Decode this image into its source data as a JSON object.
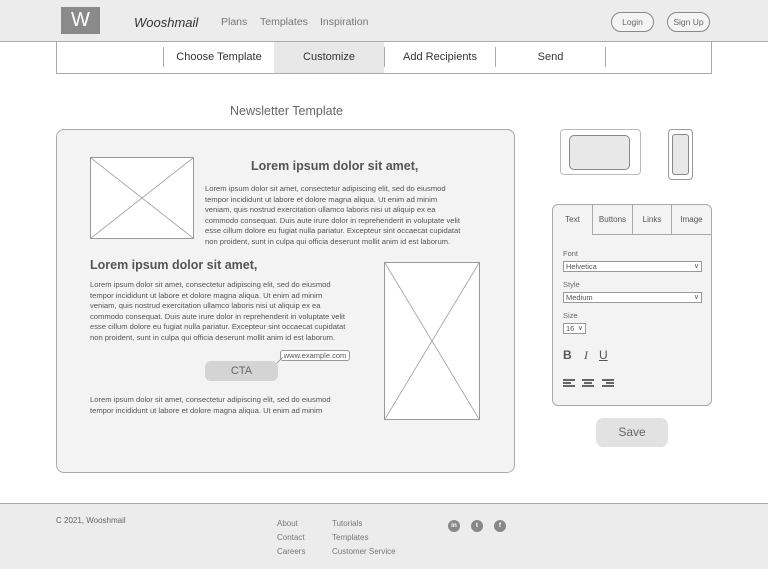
{
  "header": {
    "logo": "W",
    "brand": "Wooshmail",
    "nav": [
      "Plans",
      "Templates",
      "Inspiration"
    ],
    "login_label": "Login",
    "signup_label": "Sign Up"
  },
  "steps": [
    "Choose Template",
    "Customize",
    "Add Recipients",
    "Send"
  ],
  "page_title": "Newsletter Template",
  "template": {
    "heading1": "Lorem ipsum dolor sit amet,",
    "body1": [
      "Lorem ipsum dolor sit amet, consectetur adipiscing elit, sed do eiusmod",
      "tempor incididunt ut labore et dolore magna aliqua. Ut enim ad minim",
      "veniam, quis nostrud exercitation ullamco laboris nisi ut aliquip ex ea",
      "commodo consequat. Duis aute irure dolor in reprehenderit in voluptate velit",
      "esse cillum dolore eu fugiat nulla pariatur. Excepteur sint occaecat cupidatat",
      "non proident, sunt in culpa qui officia deserunt mollit anim id est laborum."
    ],
    "heading2": "Lorem ipsum dolor sit amet,",
    "body2": [
      "Lorem ipsum dolor sit amet, consectetur adipiscing elit, sed do eiusmod",
      "tempor incididunt ut labore et dolore magna aliqua. Ut enim ad minim",
      "veniam, quis nostrud exercitation ullamco laboris nisi ut aliquip ex ea",
      "commodo consequat. Duis aute irure dolor in reprehenderit in voluptate velit",
      "esse cillum dolore eu fugiat nulla pariatur. Excepteur sint occaecat cupidatat",
      "non proident, sunt in culpa qui officia deserunt mollit anim id est laborum."
    ],
    "url": "www.example.com",
    "cta_label": "CTA",
    "body3": [
      "Lorem ipsum dolor sit amet, consectetur adipiscing elit, sed do eiusmod",
      "tempor incididunt ut labore et dolore magna aliqua. Ut enim ad minim"
    ]
  },
  "panel": {
    "tabs": [
      "Text",
      "Buttons",
      "Links",
      "Image"
    ],
    "font_label": "Font",
    "font_value": "Helvetica",
    "style_label": "Style",
    "style_value": "Medium",
    "size_label": "Size",
    "size_value": "16",
    "bold": "B",
    "italic": "I",
    "underline": "U",
    "dropdown_arrow": "∨"
  },
  "save_label": "Save",
  "footer": {
    "copyright": "C 2021, Wooshmail",
    "col1": [
      "About",
      "Contact",
      "Careers"
    ],
    "col2": [
      "Tutorials",
      "Templates",
      "Customer Service"
    ],
    "social": [
      "in",
      "t",
      "f"
    ]
  },
  "icons": [
    "close-x-placeholder-icon",
    "desktop-preview-icon",
    "mobile-preview-icon",
    "align-left-icon",
    "align-center-icon",
    "align-right-icon",
    "linkedin-icon",
    "twitter-icon",
    "facebook-icon"
  ]
}
